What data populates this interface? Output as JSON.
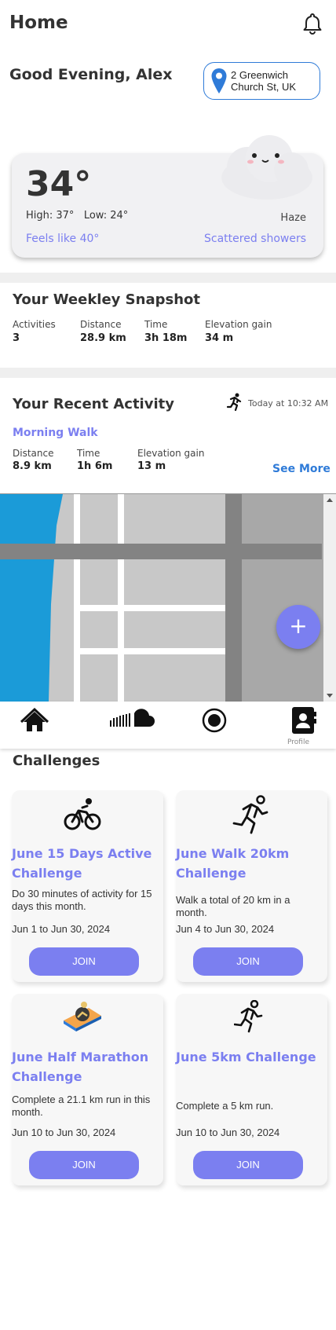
{
  "header": {
    "title": "Home"
  },
  "greeting": "Good Evening, Alex",
  "location": {
    "line1": "2 Greenwich",
    "line2": "Church St, UK"
  },
  "weather": {
    "temperature": "34°",
    "high": "High: 37°",
    "low": "Low: 24°",
    "condition": "Haze",
    "feels_like": "Feels like 40°",
    "forecast": "Scattered showers"
  },
  "weekly": {
    "title": "Your Weekley Snapshot",
    "stats": [
      {
        "label": "Activities",
        "value": "3"
      },
      {
        "label": "Distance",
        "value": "28.9 km"
      },
      {
        "label": "Time",
        "value": "3h 18m"
      },
      {
        "label": "Elevation gain",
        "value": "34 m"
      }
    ]
  },
  "recent": {
    "title": "Your Recent Activity",
    "timestamp": "Today at 10:32 AM",
    "activity_name": "Morning Walk",
    "stats": [
      {
        "label": "Distance",
        "value": "8.9 km"
      },
      {
        "label": "Time",
        "value": "1h 6m"
      },
      {
        "label": "Elevation gain",
        "value": "13 m"
      }
    ],
    "see_more": "See More"
  },
  "map": {
    "fab_label": "+"
  },
  "tabbar": {
    "items": [
      {
        "icon": "home-icon"
      },
      {
        "icon": "soundcloud-icon"
      },
      {
        "icon": "record-icon"
      },
      {
        "icon": "contacts-icon"
      }
    ],
    "partial_label": "Profile"
  },
  "challenges": {
    "title": "Challenges",
    "cards": [
      {
        "icon": "bicycle-icon",
        "title_line1": "June 15 Days Active",
        "title_line2": "Challenge",
        "description": "Do 30 minutes of activity for 15 days this month.",
        "dates": "Jun 1 to Jun 30, 2024",
        "button": "JOIN"
      },
      {
        "icon": "running-icon",
        "title_line1": "June Walk 20km",
        "title_line2": "Challenge",
        "description": "Walk a total of 20 km in a month.",
        "dates": "Jun 4 to Jun 30, 2024",
        "button": "JOIN"
      },
      {
        "icon": "marathon-runner-icon",
        "title_line1": "June Half Marathon",
        "title_line2": "Challenge",
        "description": "Complete a 21.1 km run in this month.",
        "dates": "Jun 10 to Jun 30, 2024",
        "button": "JOIN"
      },
      {
        "icon": "sprint-icon",
        "title_line1": "June 5km Challenge",
        "title_line2": "",
        "description": "Complete a 5 km run.",
        "dates": "Jun 10 to Jun 30, 2024",
        "button": "JOIN"
      }
    ]
  },
  "colors": {
    "accent": "#7b7ff0",
    "link": "#2f7bd8",
    "water": "#1b9bd8"
  }
}
